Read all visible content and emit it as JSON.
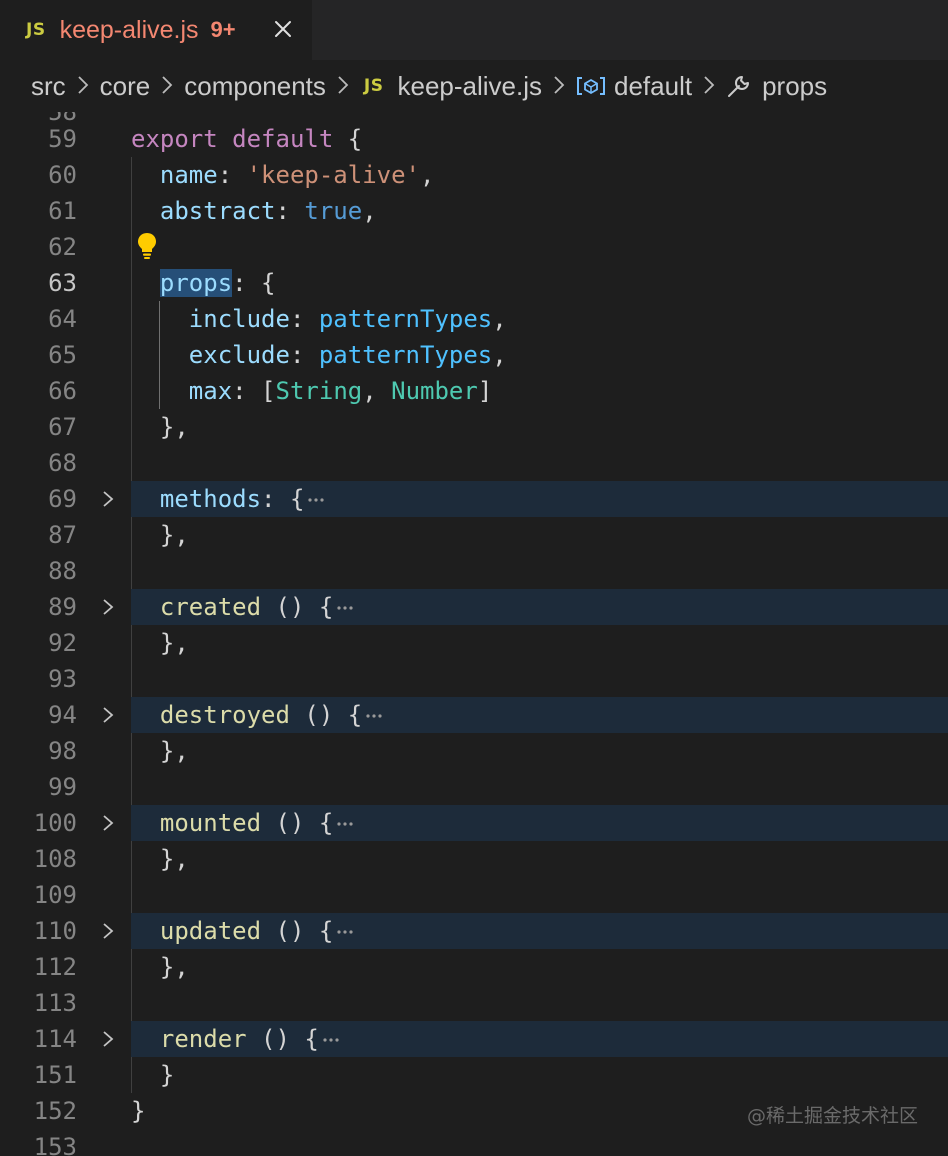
{
  "tab": {
    "lang_badge": "JS",
    "title": "keep-alive.js",
    "problem_count": "9+"
  },
  "breadcrumb": {
    "items": [
      "src",
      "core",
      "components",
      "keep-alive.js",
      "default",
      "props"
    ],
    "file_badge": "JS"
  },
  "editor": {
    "partial_top_line": "58",
    "lines": [
      {
        "n": "59",
        "tokens": [
          [
            "kw",
            "export"
          ],
          [
            "punc",
            " "
          ],
          [
            "kw",
            "default"
          ],
          [
            "punc",
            " {"
          ]
        ]
      },
      {
        "n": "60",
        "tokens": [
          [
            "prop",
            "name"
          ],
          [
            "punc",
            ": "
          ],
          [
            "str",
            "'keep-alive'"
          ],
          [
            "punc",
            ","
          ]
        ]
      },
      {
        "n": "61",
        "tokens": [
          [
            "prop",
            "abstract"
          ],
          [
            "punc",
            ": "
          ],
          [
            "bool",
            "true"
          ],
          [
            "punc",
            ","
          ]
        ]
      },
      {
        "n": "62",
        "tokens": []
      },
      {
        "n": "63",
        "tokens": [
          [
            "prop",
            "props"
          ],
          [
            "punc",
            ": {"
          ]
        ]
      },
      {
        "n": "64",
        "tokens": [
          [
            "prop",
            "include"
          ],
          [
            "punc",
            ": "
          ],
          [
            "ident",
            "patternTypes"
          ],
          [
            "punc",
            ","
          ]
        ]
      },
      {
        "n": "65",
        "tokens": [
          [
            "prop",
            "exclude"
          ],
          [
            "punc",
            ": "
          ],
          [
            "ident",
            "patternTypes"
          ],
          [
            "punc",
            ","
          ]
        ]
      },
      {
        "n": "66",
        "tokens": [
          [
            "prop",
            "max"
          ],
          [
            "punc",
            ": ["
          ],
          [
            "type",
            "String"
          ],
          [
            "punc",
            ", "
          ],
          [
            "type",
            "Number"
          ],
          [
            "punc",
            "]"
          ]
        ]
      },
      {
        "n": "67",
        "tokens": [
          [
            "punc",
            "},"
          ]
        ]
      },
      {
        "n": "68",
        "tokens": []
      },
      {
        "n": "69",
        "tokens": [
          [
            "prop",
            "methods"
          ],
          [
            "punc",
            ": {"
          ]
        ]
      },
      {
        "n": "87",
        "tokens": [
          [
            "punc",
            "},"
          ]
        ]
      },
      {
        "n": "88",
        "tokens": []
      },
      {
        "n": "89",
        "tokens": [
          [
            "fn",
            "created"
          ],
          [
            "punc",
            " () {"
          ]
        ]
      },
      {
        "n": "92",
        "tokens": [
          [
            "punc",
            "},"
          ]
        ]
      },
      {
        "n": "93",
        "tokens": []
      },
      {
        "n": "94",
        "tokens": [
          [
            "fn",
            "destroyed"
          ],
          [
            "punc",
            " () {"
          ]
        ]
      },
      {
        "n": "98",
        "tokens": [
          [
            "punc",
            "},"
          ]
        ]
      },
      {
        "n": "99",
        "tokens": []
      },
      {
        "n": "100",
        "tokens": [
          [
            "fn",
            "mounted"
          ],
          [
            "punc",
            " () {"
          ]
        ]
      },
      {
        "n": "108",
        "tokens": [
          [
            "punc",
            "},"
          ]
        ]
      },
      {
        "n": "109",
        "tokens": []
      },
      {
        "n": "110",
        "tokens": [
          [
            "fn",
            "updated"
          ],
          [
            "punc",
            " () {"
          ]
        ]
      },
      {
        "n": "112",
        "tokens": [
          [
            "punc",
            "},"
          ]
        ]
      },
      {
        "n": "113",
        "tokens": []
      },
      {
        "n": "114",
        "tokens": [
          [
            "fn",
            "render"
          ],
          [
            "punc",
            " () {"
          ]
        ]
      },
      {
        "n": "151",
        "tokens": [
          [
            "punc",
            "}"
          ]
        ]
      },
      {
        "n": "152",
        "tokens": [
          [
            "punc",
            "}"
          ]
        ]
      },
      {
        "n": "153",
        "tokens": []
      }
    ]
  },
  "watermark": "@稀土掘金技术社区",
  "colors": {
    "background": "#1e1e1e",
    "keyword": "#c586c0",
    "property": "#9cdcfe",
    "string": "#ce9178",
    "boolean": "#569cd6",
    "identifier": "#4fc1ff",
    "type": "#4ec9b0",
    "function": "#dcdcaa",
    "folded_line_bg": "#1d2b3a",
    "tab_title": "#f48771"
  }
}
